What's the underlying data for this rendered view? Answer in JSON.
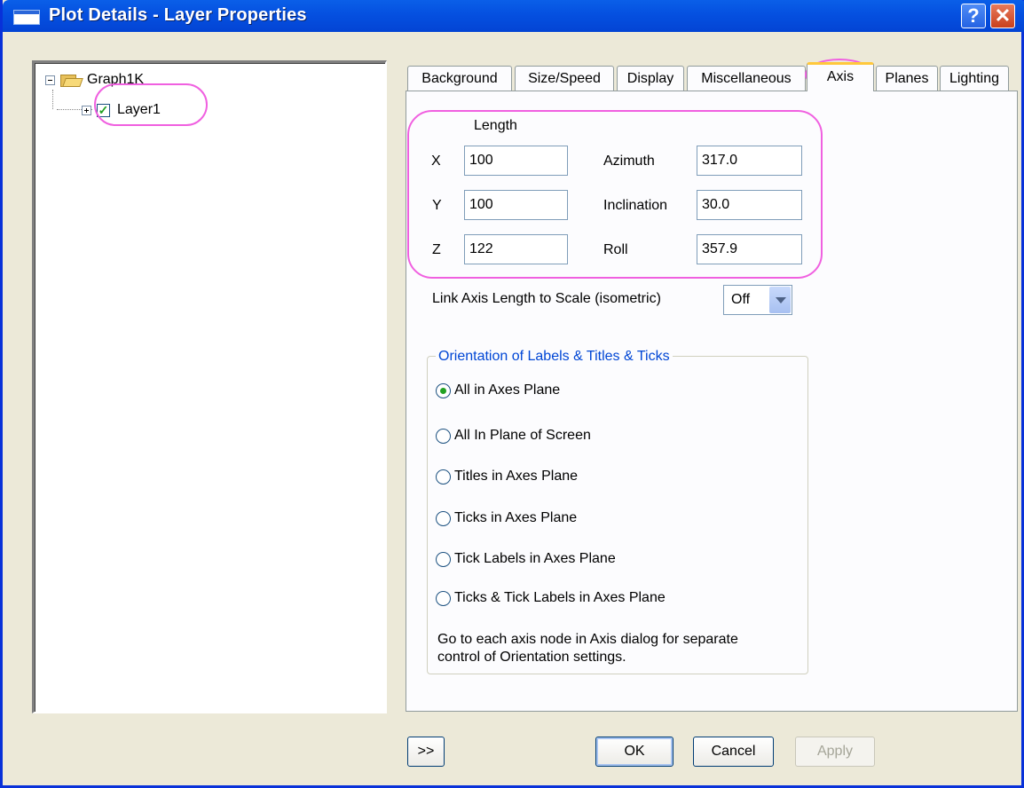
{
  "window": {
    "title": "Plot Details - Layer Properties"
  },
  "titlebar_buttons": {
    "help": "?",
    "close": "✕"
  },
  "tree": {
    "root": {
      "label": "Graph1K",
      "expander": "minus",
      "icon": "folder-open-icon"
    },
    "child": {
      "label": "Layer1",
      "expander": "plus",
      "checked": true
    }
  },
  "tabs": [
    {
      "label": "Background",
      "active": false
    },
    {
      "label": "Size/Speed",
      "active": false
    },
    {
      "label": "Display",
      "active": false
    },
    {
      "label": "Miscellaneous",
      "active": false
    },
    {
      "label": "Axis",
      "active": true
    },
    {
      "label": "Planes",
      "active": false
    },
    {
      "label": "Lighting",
      "active": false
    }
  ],
  "axis": {
    "length_label": "Length",
    "x": {
      "label": "X",
      "value": "100"
    },
    "y": {
      "label": "Y",
      "value": "100"
    },
    "z": {
      "label": "Z",
      "value": "122"
    },
    "azimuth": {
      "label": "Azimuth",
      "value": "317.0"
    },
    "inclination": {
      "label": "Inclination",
      "value": "30.0"
    },
    "roll": {
      "label": "Roll",
      "value": "357.9"
    },
    "link_label": "Link Axis Length to Scale (isometric)",
    "link_value": "Off"
  },
  "orientation": {
    "title": "Orientation of Labels & Titles & Ticks",
    "options": [
      {
        "label": "All in Axes Plane",
        "selected": true
      },
      {
        "label": "All In Plane of Screen",
        "selected": false
      },
      {
        "label": "Titles in Axes Plane",
        "selected": false
      },
      {
        "label": "Ticks in Axes Plane",
        "selected": false
      },
      {
        "label": "Tick Labels in Axes Plane",
        "selected": false
      },
      {
        "label": "Ticks & Tick Labels in Axes Plane",
        "selected": false
      }
    ],
    "note_line1": "Go to each axis node in Axis dialog for separate",
    "note_line2": "control of Orientation settings."
  },
  "buttons": {
    "more": ">>",
    "ok": "OK",
    "cancel": "Cancel",
    "apply": "Apply"
  },
  "colors": {
    "highlight": "#f060e0",
    "titlebar": "#0550e0",
    "group_title": "#0046d5",
    "check": "#21a121"
  }
}
